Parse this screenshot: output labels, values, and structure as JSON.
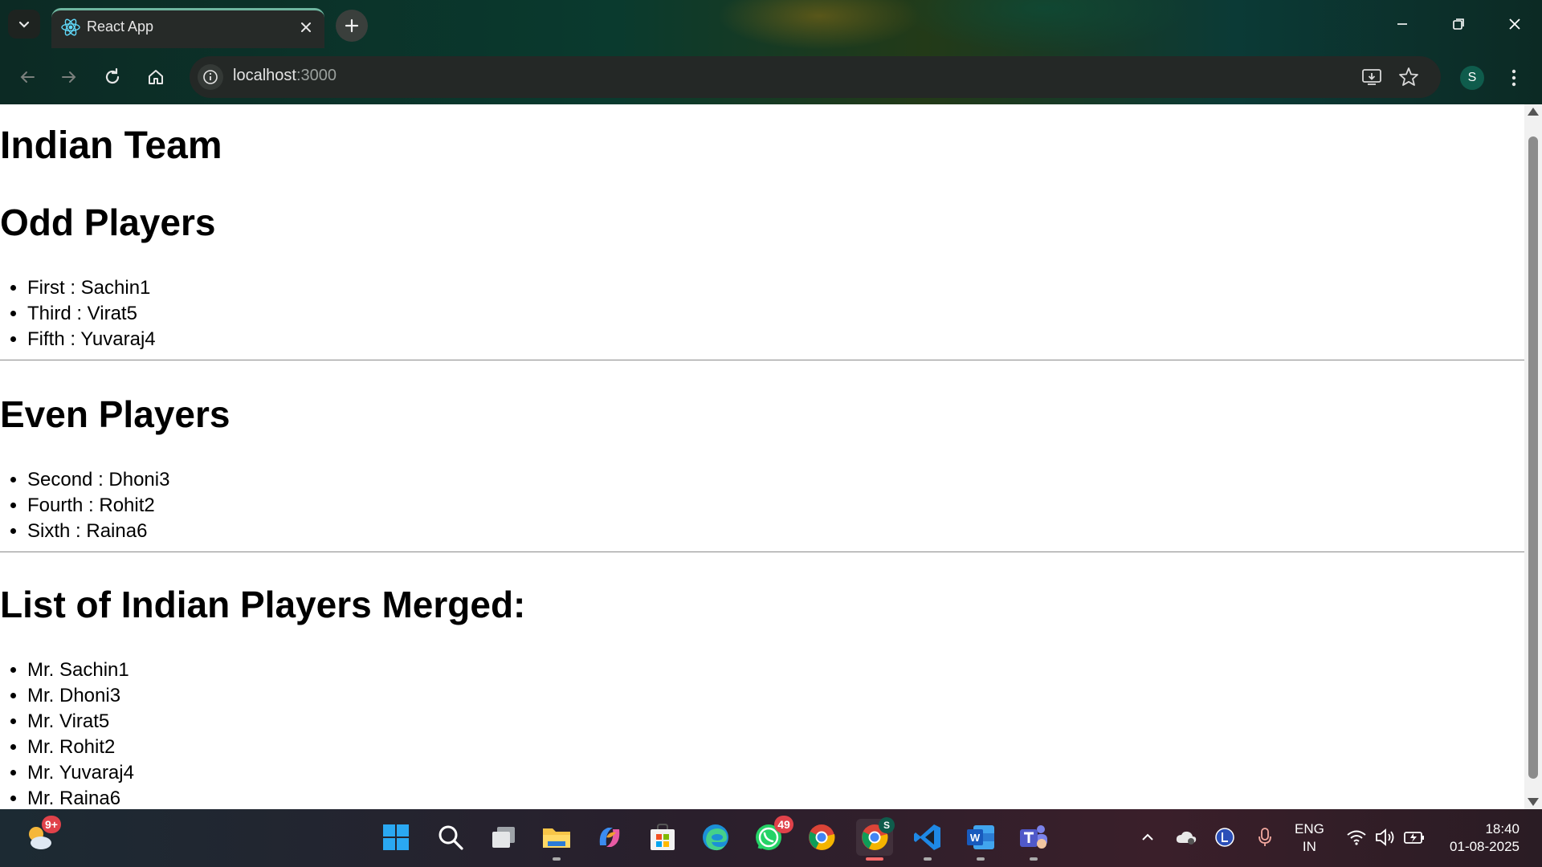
{
  "browser": {
    "tab_title": "React App",
    "url_host": "localhost",
    "url_port": ":3000",
    "profile_initial": "S"
  },
  "page": {
    "title": "Indian Team",
    "odd": {
      "heading": "Odd Players",
      "items": [
        "First : Sachin1",
        "Third : Virat5",
        "Fifth : Yuvaraj4"
      ]
    },
    "even": {
      "heading": "Even Players",
      "items": [
        "Second : Dhoni3",
        "Fourth : Rohit2",
        "Sixth : Raina6"
      ]
    },
    "merged": {
      "heading": "List of Indian Players Merged:",
      "items": [
        "Mr. Sachin1",
        "Mr. Dhoni3",
        "Mr. Virat5",
        "Mr. Rohit2",
        "Mr. Yuvaraj4",
        "Mr. Raina6"
      ]
    }
  },
  "taskbar": {
    "weather_badge": "9+",
    "whatsapp_badge": "49",
    "chrome_profile_badge": "S",
    "lang_line1": "ENG",
    "lang_line2": "IN",
    "time": "18:40",
    "date": "01-08-2025"
  },
  "icons": {
    "colors": {
      "accent_tab": "#6fb6a0",
      "profile": "#0f5c4c",
      "badge": "#e0424a"
    }
  }
}
